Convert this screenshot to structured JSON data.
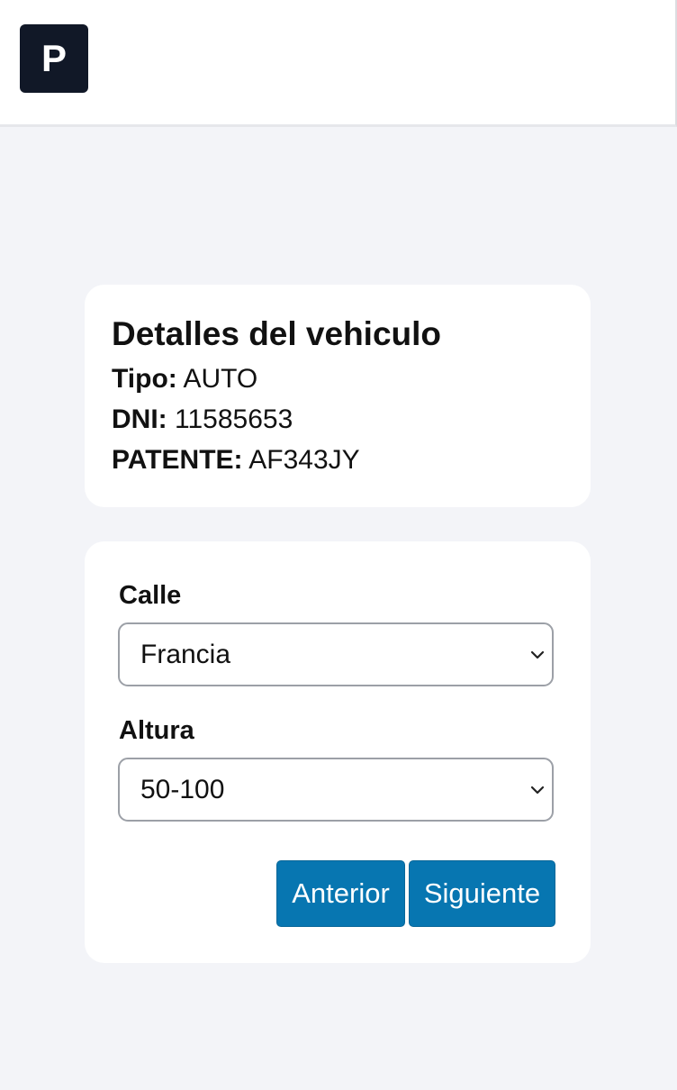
{
  "header": {
    "logo_text": "P"
  },
  "details": {
    "title": "Detalles del vehiculo",
    "tipo_label": "Tipo:",
    "tipo_value": "AUTO",
    "dni_label": "DNI:",
    "dni_value": "11585653",
    "patente_label": "PATENTE:",
    "patente_value": "AF343JY"
  },
  "form": {
    "calle_label": "Calle",
    "calle_value": "Francia",
    "altura_label": "Altura",
    "altura_value": "50-100",
    "prev_label": "Anterior",
    "next_label": "Siguiente"
  },
  "colors": {
    "logo_bg": "#111827",
    "button_bg": "#0776b1",
    "page_bg": "#f3f4f8"
  },
  "icons": {
    "select_chevron": "chevron-down-icon"
  }
}
